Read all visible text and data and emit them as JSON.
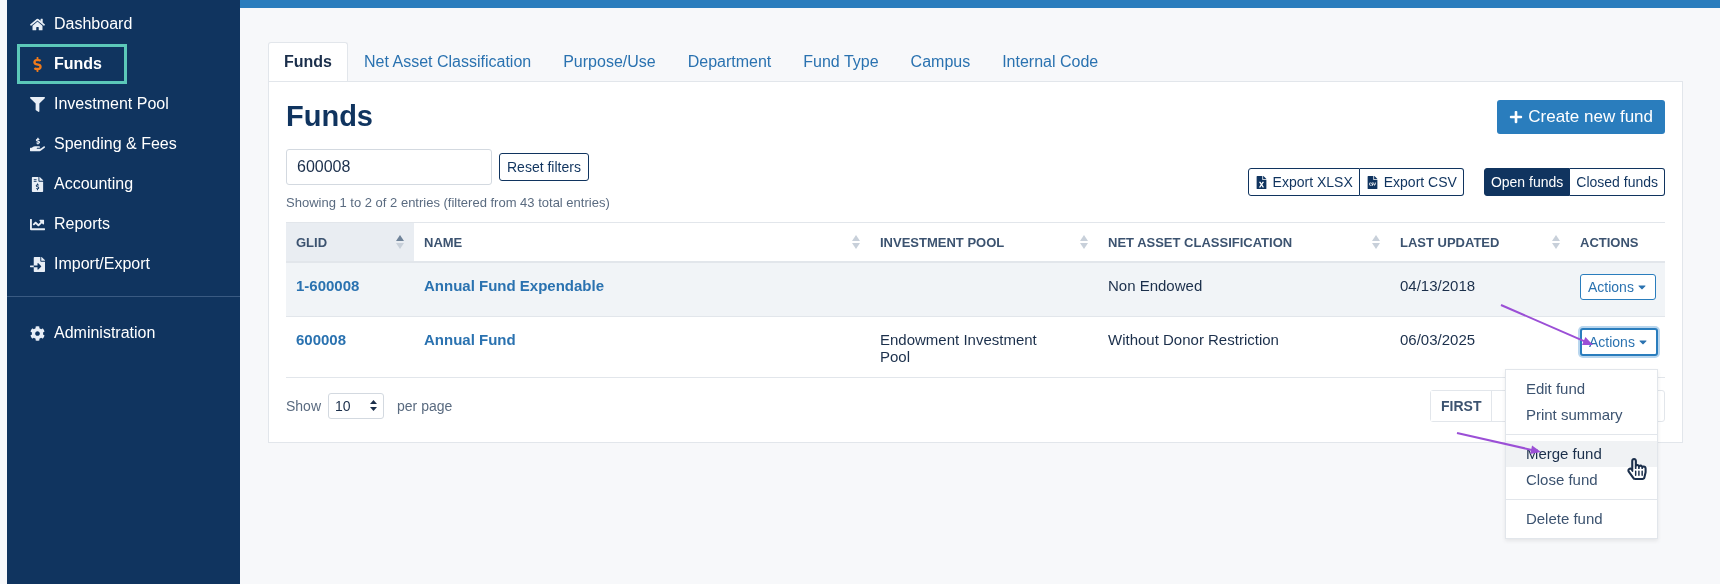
{
  "sidebar": {
    "items": [
      {
        "label": "Dashboard",
        "selected": false
      },
      {
        "label": "Funds",
        "selected": true
      },
      {
        "label": "Investment Pool",
        "selected": false
      },
      {
        "label": "Spending & Fees",
        "selected": false
      },
      {
        "label": "Accounting",
        "selected": false
      },
      {
        "label": "Reports",
        "selected": false
      },
      {
        "label": "Import/Export",
        "selected": false
      }
    ],
    "footer_items": [
      {
        "label": "Administration",
        "selected": false
      }
    ]
  },
  "tabs": [
    {
      "label": "Funds",
      "selected": true
    },
    {
      "label": "Net Asset Classification",
      "selected": false
    },
    {
      "label": "Purpose/Use",
      "selected": false
    },
    {
      "label": "Department",
      "selected": false
    },
    {
      "label": "Fund Type",
      "selected": false
    },
    {
      "label": "Campus",
      "selected": false
    },
    {
      "label": "Internal Code",
      "selected": false
    }
  ],
  "title": "Funds",
  "create_button": "Create new fund",
  "search": {
    "value": "600008"
  },
  "reset_button": "Reset filters",
  "summary": "Showing 1 to 2 of 2 entries (filtered from 43 total entries)",
  "export_buttons": [
    "Export XLSX",
    "Export CSV"
  ],
  "status_toggle": [
    {
      "label": "Open funds",
      "selected": true
    },
    {
      "label": "Closed funds",
      "selected": false
    }
  ],
  "table": {
    "columns": [
      {
        "label": "GLID",
        "sortable": true,
        "sorted": true
      },
      {
        "label": "NAME",
        "sortable": true,
        "sorted": false
      },
      {
        "label": "INVESTMENT POOL",
        "sortable": true,
        "sorted": false
      },
      {
        "label": "NET ASSET CLASSIFICATION",
        "sortable": true,
        "sorted": false
      },
      {
        "label": "LAST UPDATED",
        "sortable": true,
        "sorted": false
      },
      {
        "label": "ACTIONS",
        "sortable": false,
        "sorted": false
      }
    ],
    "rows": [
      {
        "glid": "1-600008",
        "name": "Annual Fund Expendable",
        "investment_pool": "",
        "net_asset_classification": "Non Endowed",
        "last_updated": "04/13/2018",
        "actions": "Actions",
        "highlighted": true,
        "menu_open": false
      },
      {
        "glid": "600008",
        "name": "Annual Fund",
        "investment_pool": "Endowment Investment Pool",
        "net_asset_classification": "Without Donor Restriction",
        "last_updated": "06/03/2025",
        "actions": "Actions",
        "highlighted": false,
        "menu_open": true
      }
    ]
  },
  "actions_menu": {
    "sections": [
      [
        {
          "label": "Edit fund",
          "selected": false
        },
        {
          "label": "Print summary",
          "selected": false
        }
      ],
      [
        {
          "label": "Merge fund",
          "selected": true
        },
        {
          "label": "Close fund",
          "selected": false
        }
      ],
      [
        {
          "label": "Delete fund",
          "selected": false
        }
      ]
    ]
  },
  "pagination": {
    "show_label": "Show",
    "page_size": "10",
    "per_page_label": "per page",
    "pager": [
      "FIRST"
    ]
  }
}
